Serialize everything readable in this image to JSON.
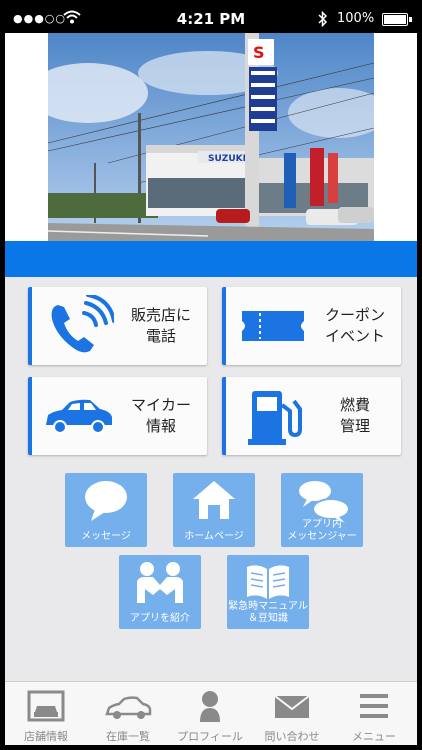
{
  "status_bar": {
    "signal": "●●●○○",
    "time": "4:21 PM",
    "battery": "100%"
  },
  "hero": {
    "sign_text": "SUZUKI"
  },
  "big_buttons": [
    {
      "label": "販売店に\n電話",
      "icon": "phone-icon"
    },
    {
      "label": "クーポン\nイベント",
      "icon": "ticket-icon"
    },
    {
      "label": "マイカー\n情報",
      "icon": "car-icon"
    },
    {
      "label": "燃費\n管理",
      "icon": "fuel-pump-icon"
    }
  ],
  "tiles": [
    {
      "label": "メッセージ",
      "icon": "speech-bubble-icon"
    },
    {
      "label": "ホームページ",
      "icon": "home-icon"
    },
    {
      "label": "アプリ内\nメッセンジャー",
      "icon": "chat-bubbles-icon"
    },
    {
      "label": "アプリを紹介",
      "icon": "people-icon"
    },
    {
      "label": "緊急時マニュアル\n＆豆知識",
      "icon": "book-icon"
    }
  ],
  "tabbar": {
    "items": [
      {
        "label": "店舗情報",
        "icon": "garage-icon"
      },
      {
        "label": "在庫一覧",
        "icon": "car-outline-icon"
      },
      {
        "label": "プロフィール",
        "icon": "person-icon"
      },
      {
        "label": "問い合わせ",
        "icon": "mail-icon"
      },
      {
        "label": "メニュー",
        "icon": "hamburger-menu-icon"
      }
    ]
  },
  "colors": {
    "accent": "#0a77e8",
    "tile": "#76b0ec",
    "tab_gray": "#8a8a8a"
  }
}
